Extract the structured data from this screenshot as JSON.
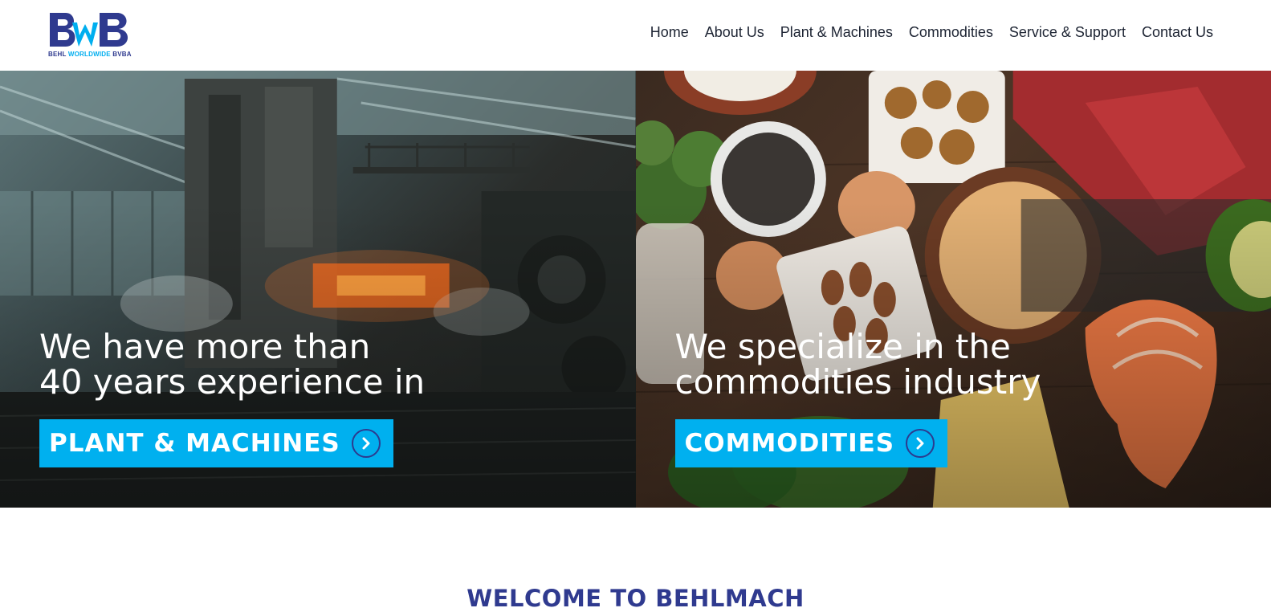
{
  "brand": {
    "logo_letters": "BWB",
    "tagline_part1": "BEHL",
    "tagline_part2": "WORLDWIDE",
    "tagline_part3": "BVBA",
    "color_primary": "#2f3a8f",
    "color_accent": "#00aeef"
  },
  "nav": {
    "items": [
      {
        "label": "Home"
      },
      {
        "label": "About Us"
      },
      {
        "label": "Plant & Machines"
      },
      {
        "label": "Commodities"
      },
      {
        "label": "Service & Support"
      },
      {
        "label": "Contact Us"
      }
    ]
  },
  "hero": {
    "left": {
      "line1": "We have more than",
      "line2": "40 years experience in",
      "cta_label": "PLANT & MACHINES",
      "cta_icon": "chevron-right-circle-icon",
      "image": "industrial-steel-mill-photo"
    },
    "right": {
      "line1": "We specialize in the",
      "line2": "commodities industry",
      "cta_label": "COMMODITIES",
      "cta_icon": "chevron-right-circle-icon",
      "image": "protein-food-assortment-photo"
    },
    "cta_color": "#00b0ef"
  },
  "welcome": {
    "heading": "WELCOME TO BEHLMACH"
  }
}
